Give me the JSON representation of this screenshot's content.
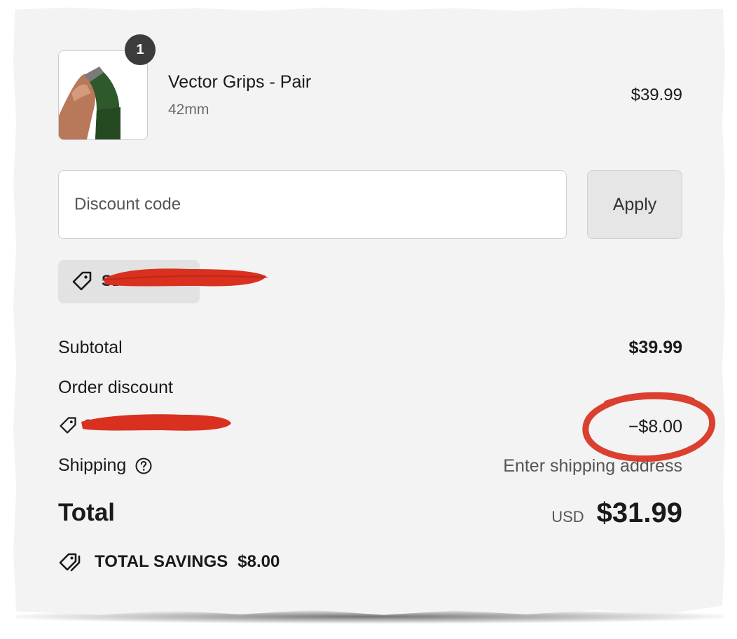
{
  "item": {
    "quantity": "1",
    "name": "Vector Grips - Pair",
    "variant": "42mm",
    "price": "$39.99",
    "image_icon": "product-grip-image"
  },
  "discount_form": {
    "placeholder": "Discount code",
    "apply_label": "Apply"
  },
  "applied_code_chip": {
    "icon": "tag-icon",
    "code": "SD20"
  },
  "summary": {
    "subtotal_label": "Subtotal",
    "subtotal_value": "$39.99",
    "order_discount_label": "Order discount",
    "discount_code": "SD20",
    "discount_value": "−$8.00",
    "shipping_label": "Shipping",
    "shipping_value": "Enter shipping address",
    "total_label": "Total",
    "currency": "USD",
    "total_value": "$31.99"
  },
  "savings": {
    "icon": "tags-icon",
    "label": "TOTAL SAVINGS",
    "value": "$8.00"
  },
  "colors": {
    "redaction": "#d9301f",
    "annotation_circle": "#d9301f",
    "panel_background": "#f3f3f3",
    "badge": "#3c3c3c"
  }
}
